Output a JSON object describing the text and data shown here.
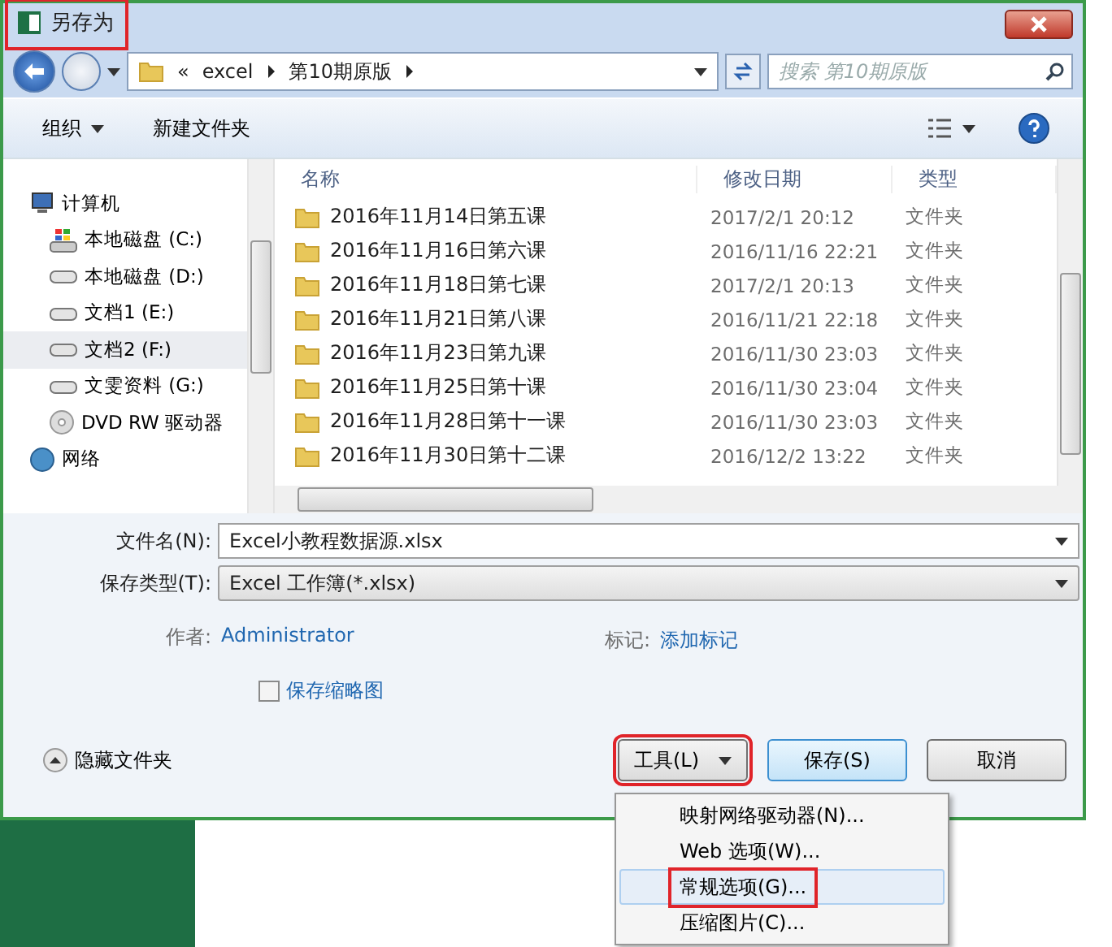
{
  "window": {
    "title": "另存为",
    "highlighted": true
  },
  "address_bar": {
    "prefix": "«",
    "path": [
      "excel",
      "第10期原版"
    ]
  },
  "search": {
    "placeholder": "搜索 第10期原版"
  },
  "toolbar": {
    "items": [
      {
        "label": "组织",
        "has_menu": true
      },
      {
        "label": "新建文件夹",
        "has_menu": false
      }
    ]
  },
  "sidebar": {
    "items": [
      {
        "label": "计算机",
        "kind": "computer",
        "selected": false,
        "children": [
          {
            "label": "本地磁盘 (C:)",
            "kind": "system-drive",
            "selected": false
          },
          {
            "label": "本地磁盘 (D:)",
            "kind": "drive",
            "selected": false
          },
          {
            "label": "文档1 (E:)",
            "kind": "drive",
            "selected": false
          },
          {
            "label": "文档2 (F:)",
            "kind": "drive",
            "selected": true
          },
          {
            "label": "文雯资料 (G:)",
            "kind": "drive",
            "selected": false
          },
          {
            "label": "DVD RW 驱动器",
            "kind": "dvd",
            "selected": false
          }
        ]
      },
      {
        "label": "网络",
        "kind": "network",
        "selected": false
      }
    ]
  },
  "file_list": {
    "columns": [
      "名称",
      "修改日期",
      "类型"
    ],
    "rows": [
      {
        "name": "2016年11月14日第五课",
        "modified": "2017/2/1 20:12",
        "type": "文件夹"
      },
      {
        "name": "2016年11月16日第六课",
        "modified": "2016/11/16 22:21",
        "type": "文件夹"
      },
      {
        "name": "2016年11月18日第七课",
        "modified": "2017/2/1 20:13",
        "type": "文件夹"
      },
      {
        "name": "2016年11月21日第八课",
        "modified": "2016/11/21 22:18",
        "type": "文件夹"
      },
      {
        "name": "2016年11月23日第九课",
        "modified": "2016/11/30 23:03",
        "type": "文件夹"
      },
      {
        "name": "2016年11月25日第十课",
        "modified": "2016/11/30 23:04",
        "type": "文件夹"
      },
      {
        "name": "2016年11月28日第十一课",
        "modified": "2016/11/30 23:03",
        "type": "文件夹"
      },
      {
        "name": "2016年11月30日第十二课",
        "modified": "2016/12/2 13:22",
        "type": "文件夹"
      }
    ]
  },
  "form": {
    "file_name": {
      "label": "文件名(N):",
      "value": "Excel小教程数据源.xlsx"
    },
    "save_type": {
      "label": "保存类型(T):",
      "value": "Excel 工作簿(*.xlsx)"
    },
    "author": {
      "label": "作者:",
      "value": "Administrator"
    },
    "tags": {
      "label": "标记:",
      "value": "添加标记"
    },
    "thumbnail": {
      "label": "保存缩略图",
      "checked": false
    }
  },
  "footer": {
    "hide_folders": "隐藏文件夹",
    "buttons": [
      {
        "label": "工具(L)",
        "kind": "menu",
        "highlighted": true
      },
      {
        "label": "保存(S)",
        "kind": "default",
        "highlighted": false
      },
      {
        "label": "取消",
        "kind": "normal",
        "highlighted": false
      }
    ]
  },
  "menu": {
    "items": [
      {
        "label": "映射网络驱动器(N)...",
        "selected": false,
        "highlighted": false
      },
      {
        "label": "Web 选项(W)...",
        "selected": false,
        "highlighted": false
      },
      {
        "label": "常规选项(G)...",
        "selected": true,
        "highlighted": true
      },
      {
        "label": "压缩图片(C)...",
        "selected": false,
        "highlighted": false
      }
    ]
  }
}
